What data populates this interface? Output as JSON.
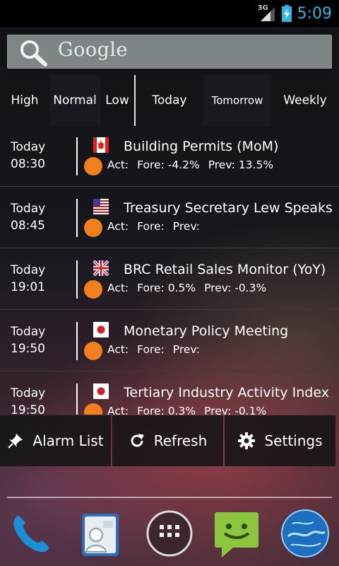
{
  "status": {
    "network": "3G",
    "time": "5:09",
    "accent": "#33b5e5"
  },
  "search": {
    "label": "Google",
    "icon": "search-icon"
  },
  "tabs": [
    {
      "label": "High"
    },
    {
      "label": "Normal",
      "selected": true
    },
    {
      "label": "Low"
    },
    {
      "label": "Today"
    },
    {
      "label": "Tomorrow",
      "selected": true
    },
    {
      "label": "Weekly"
    }
  ],
  "events": [
    {
      "day": "Today",
      "time": "08:30",
      "flag": "canada-flag-icon",
      "title": "Building Permits (MoM)",
      "act": "Act:",
      "fore": "Fore: -4.2%",
      "prev": "Prev: 13.5%"
    },
    {
      "day": "Today",
      "time": "08:45",
      "flag": "usa-flag-icon",
      "title": "Treasury Secretary Lew Speaks",
      "act": "Act:",
      "fore": "Fore:",
      "prev": "Prev:"
    },
    {
      "day": "Today",
      "time": "19:01",
      "flag": "uk-flag-icon",
      "title": "BRC Retail Sales Monitor (YoY)",
      "act": "Act:",
      "fore": "Fore: 0.5%",
      "prev": "Prev: -0.3%"
    },
    {
      "day": "Today",
      "time": "19:50",
      "flag": "japan-flag-icon",
      "title": "Monetary Policy Meeting",
      "act": "Act:",
      "fore": "Fore:",
      "prev": "Prev:"
    },
    {
      "day": "Today",
      "time": "19:50",
      "flag": "japan-flag-icon",
      "title": "Tertiary Industry Activity Index",
      "act": "Act:",
      "fore": "Fore: 0.3%",
      "prev": "Prev: -0.1%"
    }
  ],
  "menu": [
    {
      "label": "Alarm List",
      "icon": "pin-icon"
    },
    {
      "label": "Refresh",
      "icon": "refresh-icon"
    },
    {
      "label": "Settings",
      "icon": "gear-icon"
    }
  ],
  "dock": [
    {
      "icon": "phone-icon"
    },
    {
      "icon": "contacts-icon"
    },
    {
      "icon": "app-drawer-icon"
    },
    {
      "icon": "messaging-icon"
    },
    {
      "icon": "browser-globe-icon"
    }
  ],
  "colors": {
    "importance_dot": "#f07f1c"
  }
}
